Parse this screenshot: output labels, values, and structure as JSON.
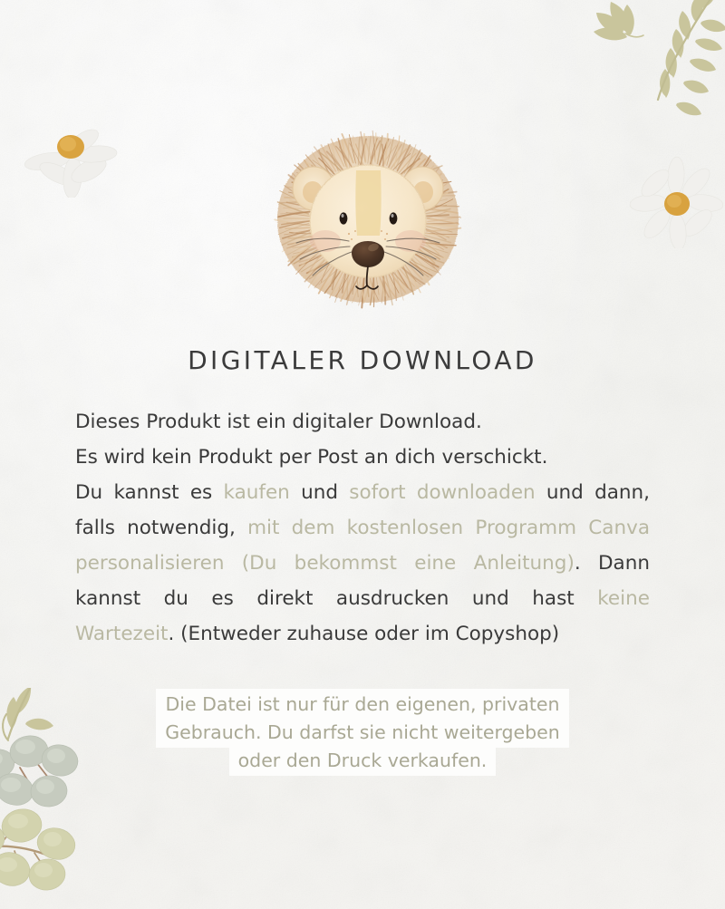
{
  "page": {
    "background_color": "#f6f6f4",
    "text_color": "#3a3a3a",
    "accent_soft_color": "#b9b8a2",
    "leaf_color": "#c8c49a",
    "eucalyptus_sage": "#c3c7bb",
    "eucalyptus_olive": "#cfcfa8",
    "stem_color": "#a98a72",
    "daisy_petal_color": "#f2f1ee",
    "daisy_center_color": "#d9a43f",
    "lion_mane_color": "#c79b6b",
    "lion_face_color": "#f6e4c6",
    "lion_nose_color": "#4a3326"
  },
  "title": {
    "text": "DIGITALER DOWNLOAD"
  },
  "body": {
    "lines": [
      {
        "justify": false,
        "segments": [
          {
            "text": "Dieses Produkt ist ein digitaler Download.",
            "tone": "dark"
          }
        ]
      },
      {
        "justify": false,
        "segments": [
          {
            "text": "Es wird kein Produkt per Post an dich verschickt.",
            "tone": "dark"
          }
        ]
      },
      {
        "justify": true,
        "segments": [
          {
            "text": "Du kannst es ",
            "tone": "dark"
          },
          {
            "text": "kaufen",
            "tone": "soft"
          },
          {
            "text": " und ",
            "tone": "dark"
          },
          {
            "text": "sofort downloaden",
            "tone": "soft"
          },
          {
            "text": " und dann,",
            "tone": "dark"
          }
        ]
      },
      {
        "justify": true,
        "segments": [
          {
            "text": "falls notwendig, ",
            "tone": "dark"
          },
          {
            "text": "mit dem kostenlosen Programm Canva",
            "tone": "soft"
          }
        ]
      },
      {
        "justify": true,
        "segments": [
          {
            "text": "personalisieren (Du bekommst eine Anleitung)",
            "tone": "soft"
          },
          {
            "text": ".  Dann",
            "tone": "dark"
          }
        ]
      },
      {
        "justify": true,
        "segments": [
          {
            "text": "kannst du es direkt ausdrucken und hast ",
            "tone": "dark"
          },
          {
            "text": "keine",
            "tone": "soft"
          }
        ]
      },
      {
        "justify": false,
        "segments": [
          {
            "text": "Wartezeit",
            "tone": "soft"
          },
          {
            "text": ". (Entweder zuhause oder im Copyshop)",
            "tone": "dark"
          }
        ]
      }
    ]
  },
  "license_note": {
    "lines": [
      "Die Datei ist nur für den eigenen, privaten",
      "Gebrauch. Du darfst sie nicht weitergeben",
      "oder den Druck verkaufen."
    ]
  },
  "decorations": [
    {
      "name": "leaf-sprig-top-right",
      "type": "olive-leaf-branch"
    },
    {
      "name": "daisy-left",
      "type": "white-daisy"
    },
    {
      "name": "daisy-right",
      "type": "white-daisy"
    },
    {
      "name": "eucalyptus-bottom-left",
      "type": "eucalyptus-branch"
    },
    {
      "name": "lion-head",
      "type": "watercolor-lion-illustration"
    }
  ]
}
